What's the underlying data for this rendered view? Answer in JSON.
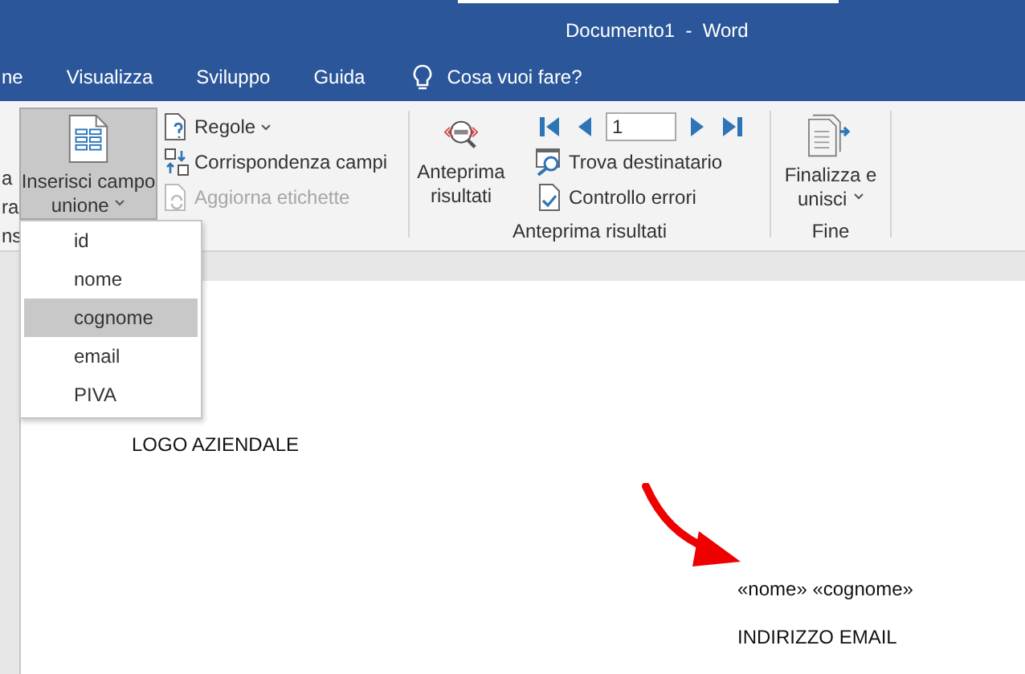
{
  "window": {
    "title": "Documento1  -  Word"
  },
  "tabs": [
    {
      "label": "ne",
      "selected": false
    },
    {
      "label": "Visualizza",
      "selected": false
    },
    {
      "label": "Sviluppo",
      "selected": false
    },
    {
      "label": "Guida",
      "selected": false
    }
  ],
  "tell_me": {
    "placeholder": "Cosa vuoi fare?"
  },
  "ribbon": {
    "cut_texts": [
      "a",
      "ra",
      "ns"
    ],
    "insert_field_button": {
      "lines": [
        "Inserisci campo",
        "unione"
      ],
      "pressed": true
    },
    "commands": [
      {
        "label": "Regole",
        "kind": "dropdown",
        "disabled": false
      },
      {
        "label": "Corrispondenza campi",
        "kind": "plain",
        "disabled": false
      },
      {
        "label": "Aggiorna etichette",
        "kind": "plain",
        "disabled": true
      }
    ],
    "preview_button": {
      "lines": [
        "Anteprima",
        "risultati"
      ]
    },
    "record": {
      "value": "1"
    },
    "preview_commands": [
      {
        "label": "Trova destinatario",
        "kind": "find"
      },
      {
        "label": "Controllo errori",
        "kind": "check"
      }
    ],
    "preview_group_label": "Anteprima risultati",
    "finish_button": {
      "lines": [
        "Finalizza e",
        "unisci"
      ]
    },
    "finish_group_label": "Fine"
  },
  "field_menu": {
    "items": [
      {
        "label": "id",
        "selected": false
      },
      {
        "label": "nome",
        "selected": false
      },
      {
        "label": "cognome",
        "selected": true
      },
      {
        "label": "email",
        "selected": false
      },
      {
        "label": "PIVA",
        "selected": false
      }
    ]
  },
  "document": {
    "logo": "LOGO AZIENDALE",
    "fields": "«nome» «cognome»",
    "email": "INDIRIZZO EMAIL"
  }
}
